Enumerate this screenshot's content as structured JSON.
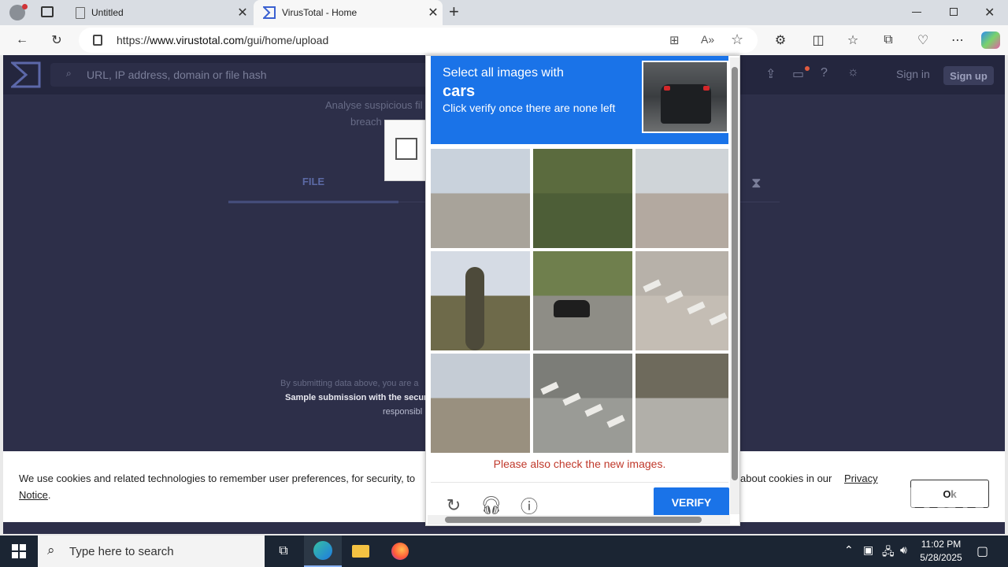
{
  "browser": {
    "tabs": [
      {
        "title": "Untitled",
        "active": false
      },
      {
        "title": "VirusTotal - Home",
        "active": true
      }
    ],
    "url_prefix": "https://",
    "url_host": "www.virustotal.com",
    "url_path": "/gui/home/upload",
    "new_tab": "+"
  },
  "virustotal": {
    "search_placeholder": "URL, IP address, domain or file hash",
    "sign_in": "Sign in",
    "sign_up": "Sign up",
    "tagline_1": "Analyse suspicious fil",
    "tagline_2": "breach",
    "file_tab": "FILE",
    "disclaimer_1": "By submitting data above, you are a",
    "disclaimer_2": "Sample submission with the secur",
    "disclaimer_3": "responsibl"
  },
  "cookie": {
    "text_start": "We use cookies and related technologies to remember user preferences, for security, to",
    "text_end": "about cookies in our",
    "privacy_link": "Privacy",
    "notice_link": "Notice",
    "ok": "Ok"
  },
  "captcha": {
    "line1": "Select all images with",
    "target": "cars",
    "line3": "Click verify once there are none left",
    "message": "Please also check the new images.",
    "verify": "VERIFY",
    "tiles": [
      {
        "name": "tile-palms-road",
        "sky": "#c9d2dc",
        "ground": "#a8a39a"
      },
      {
        "name": "tile-grass-noise",
        "sky": "#5b6b3e",
        "ground": "#4d5e37"
      },
      {
        "name": "tile-bridge",
        "sky": "#cfd4d8",
        "ground": "#b3a9a0"
      },
      {
        "name": "tile-palm-tree",
        "sky": "#d5dbe4",
        "ground": "#6e6a4a"
      },
      {
        "name": "tile-car-road",
        "sky": "#6f7f4d",
        "ground": "#8e8d86"
      },
      {
        "name": "tile-road-lines",
        "sky": "#b7b1a9",
        "ground": "#c4bdb4"
      },
      {
        "name": "tile-highway",
        "sky": "#c5ccd5",
        "ground": "#99907f"
      },
      {
        "name": "tile-crosswalk",
        "sky": "#7c7d78",
        "ground": "#9a9b96"
      },
      {
        "name": "tile-sidewalk",
        "sky": "#6e6a5c",
        "ground": "#b1afa9"
      }
    ]
  },
  "watermark": "ANY RUN",
  "taskbar": {
    "search_placeholder": "Type here to search",
    "time": "11:02 PM",
    "date": "5/28/2025"
  }
}
